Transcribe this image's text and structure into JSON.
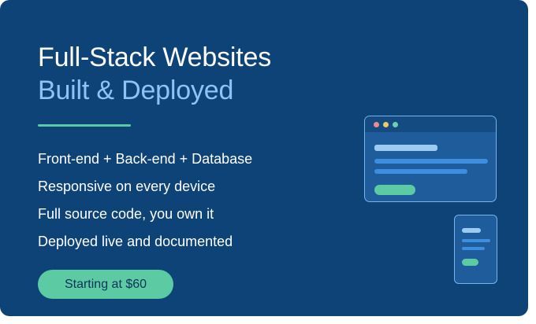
{
  "hero": {
    "title_line1": "Full-Stack Websites",
    "title_line2": "Built & Deployed",
    "features": [
      "Front-end + Back-end + Database",
      "Responsive on every device",
      "Full source code, you own it",
      "Deployed live and documented"
    ],
    "cta_label": "Starting at $60"
  },
  "illustration": {
    "browser_icon": "browser-window-icon",
    "phone_icon": "mobile-phone-icon"
  },
  "colors": {
    "background": "#0d4377",
    "title": "#ffffff",
    "subtitle": "#8cc4f5",
    "accent": "#5ccba3",
    "dot_red": "#ef8b8b",
    "dot_yellow": "#efc86a",
    "dot_green": "#6ed0b0"
  }
}
